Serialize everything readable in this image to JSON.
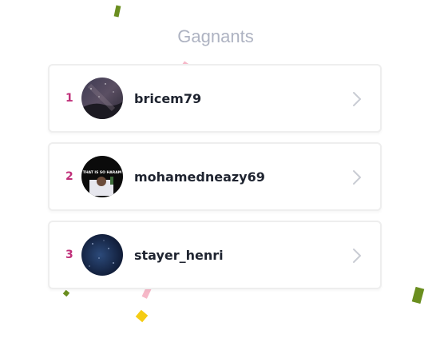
{
  "title": "Gagnants",
  "winners": [
    {
      "rank": "1",
      "username": "bricem79",
      "avatar": "night-sky-avatar"
    },
    {
      "rank": "2",
      "username": "mohamedneazy69",
      "avatar": "meme-avatar",
      "avatar_text": "THAT IS SO HARAM"
    },
    {
      "rank": "3",
      "username": "stayer_henri",
      "avatar": "galaxy-avatar"
    }
  ],
  "colors": {
    "title": "#aeb3c2",
    "rank": "#c0307a",
    "username": "#1f2430",
    "chevron": "#c9ccd4",
    "border": "#eeeeee"
  }
}
